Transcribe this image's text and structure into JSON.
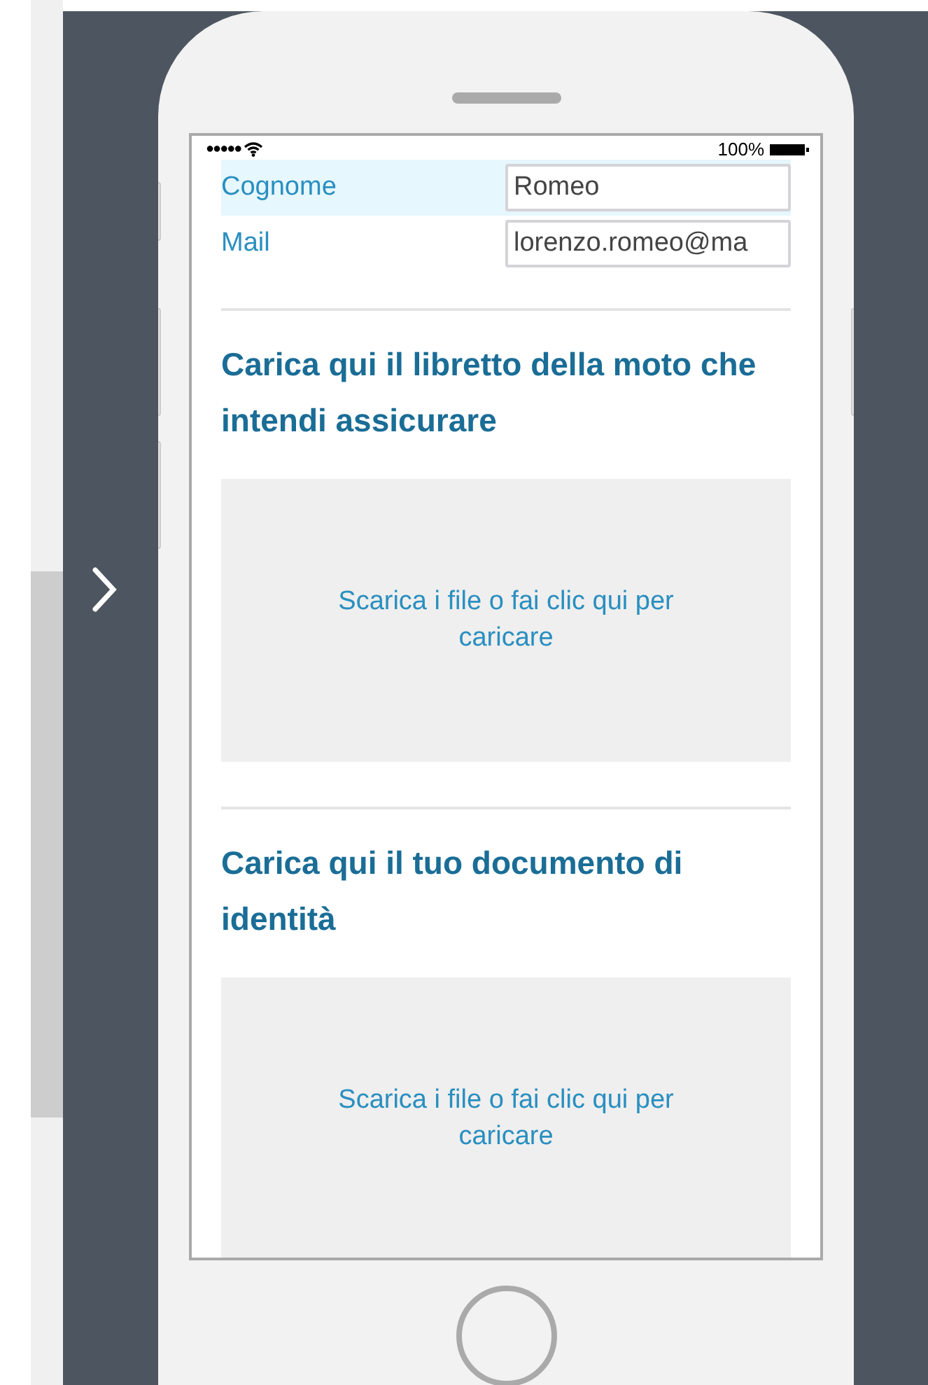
{
  "status_bar": {
    "signal_dots": "●●●●●",
    "battery_text": "100%"
  },
  "form_rows": [
    {
      "label": "Cognome",
      "value": "Romeo",
      "highlighted": true
    },
    {
      "label": "Mail",
      "value": "lorenzo.romeo@ma",
      "highlighted": false
    }
  ],
  "upload_sections": [
    {
      "heading": "Carica qui il libretto della moto che intendi assicurare",
      "dropzone_text": "Scarica i file o fai clic qui per caricare"
    },
    {
      "heading": "Carica qui il tuo documento di identità",
      "dropzone_text": "Scarica i file o fai clic qui per caricare"
    }
  ]
}
